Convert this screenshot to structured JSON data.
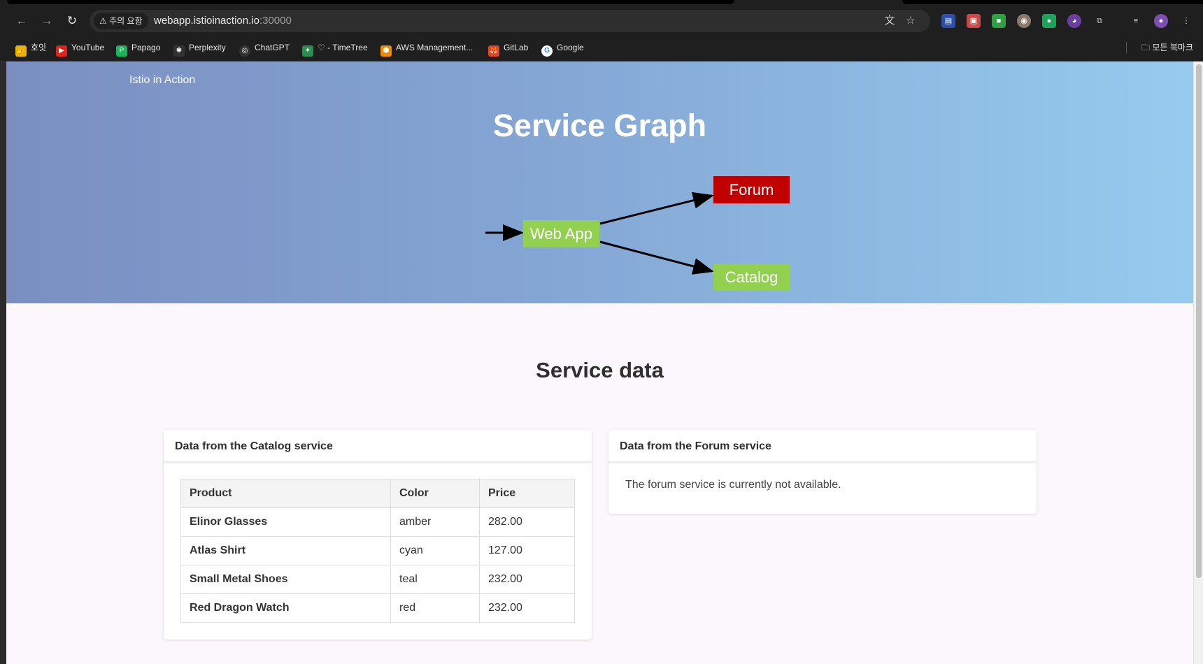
{
  "browser": {
    "security_chip": "주의 요함",
    "url_host": "webapp.istioinaction.io",
    "url_port": ":30000",
    "bookmarks": [
      {
        "label": "호잇",
        "icon": "thumbs-up-icon"
      },
      {
        "label": "YouTube",
        "icon": "youtube-icon"
      },
      {
        "label": "Papago",
        "icon": "papago-icon"
      },
      {
        "label": "Perplexity",
        "icon": "perplexity-icon"
      },
      {
        "label": "ChatGPT",
        "icon": "chatgpt-icon"
      },
      {
        "label": "♡ - TimeTree",
        "icon": "timetree-icon"
      },
      {
        "label": "AWS Management...",
        "icon": "aws-icon"
      },
      {
        "label": "GitLab",
        "icon": "gitlab-icon"
      },
      {
        "label": "Google",
        "icon": "google-icon"
      }
    ],
    "all_bookmarks": "모든 북마크"
  },
  "hero": {
    "brand": "Istio in Action",
    "title": "Service Graph",
    "nodes": {
      "webapp": "Web App",
      "forum": "Forum",
      "catalog": "Catalog"
    },
    "colors": {
      "forum": "#c00000",
      "webapp": "#92d050",
      "catalog": "#92d050"
    }
  },
  "main": {
    "section_title": "Service data",
    "catalog_card": {
      "title": "Data from the Catalog service",
      "columns": [
        "Product",
        "Color",
        "Price"
      ],
      "rows": [
        [
          "Elinor Glasses",
          "amber",
          "282.00"
        ],
        [
          "Atlas Shirt",
          "cyan",
          "127.00"
        ],
        [
          "Small Metal Shoes",
          "teal",
          "232.00"
        ],
        [
          "Red Dragon Watch",
          "red",
          "232.00"
        ]
      ]
    },
    "forum_card": {
      "title": "Data from the Forum service",
      "message": "The forum service is currently not available."
    }
  }
}
